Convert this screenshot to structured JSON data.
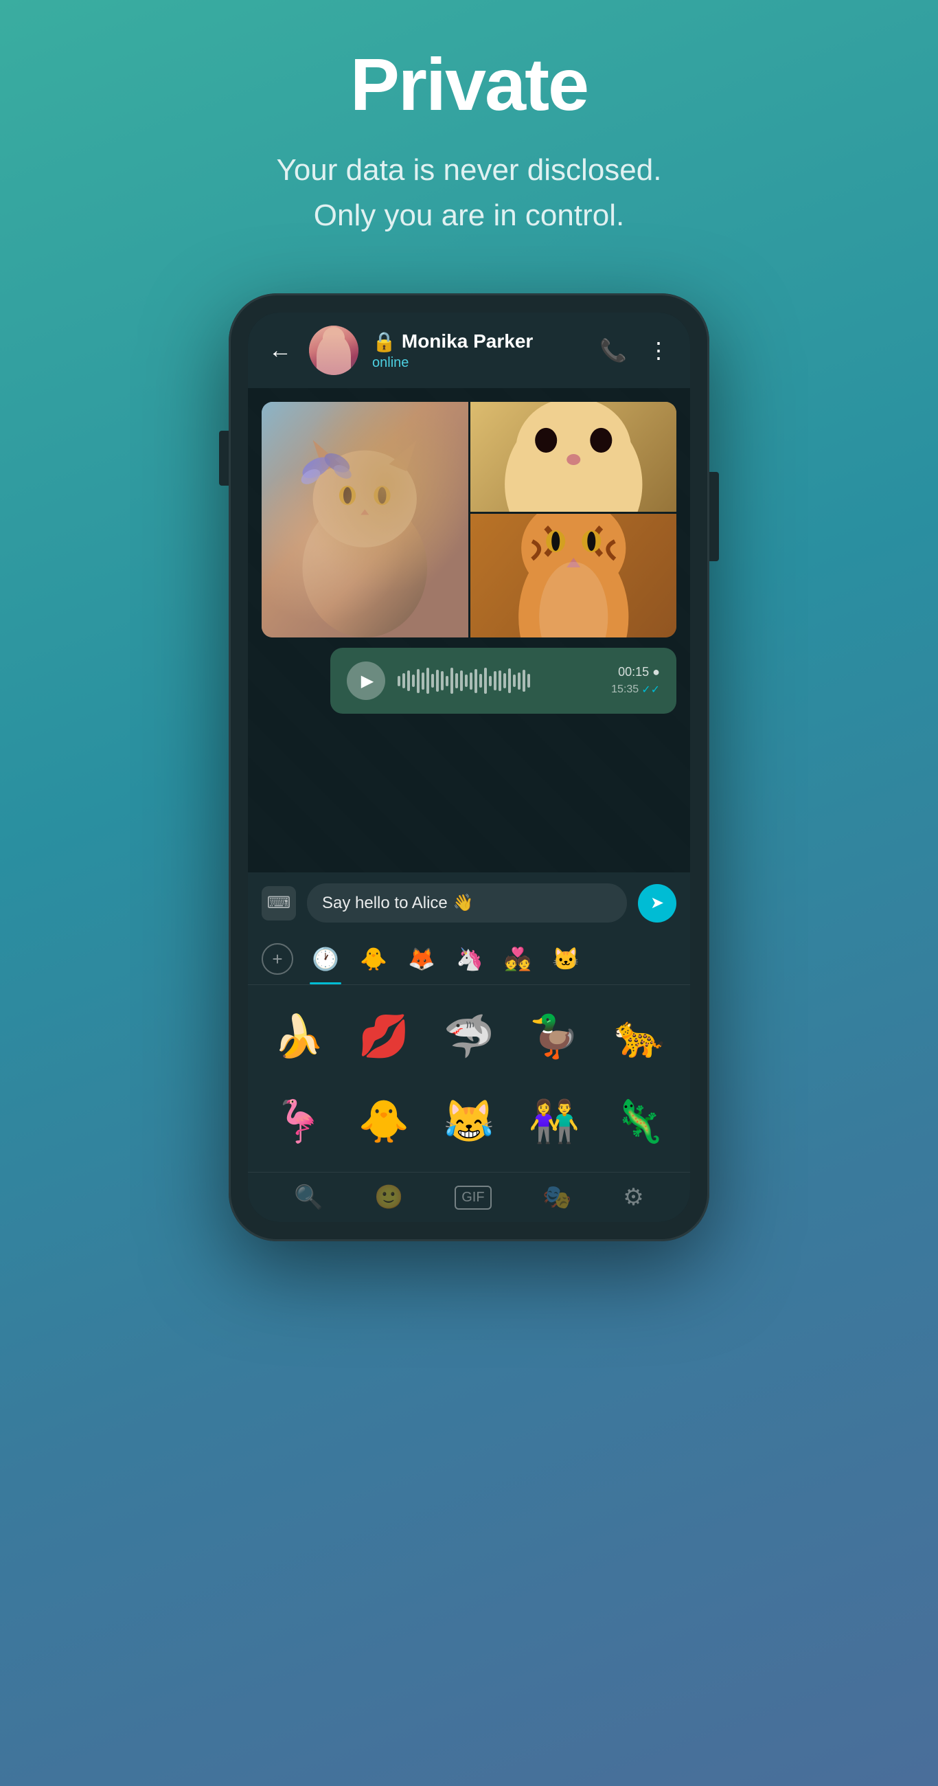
{
  "hero": {
    "title": "Private",
    "subtitle_line1": "Your data is never disclosed.",
    "subtitle_line2": "Only you are in control."
  },
  "chat": {
    "header": {
      "contact_name": "Monika Parker",
      "status": "online",
      "lock_symbol": "🔒"
    },
    "voice_message": {
      "duration": "00:15 ●",
      "time": "15:35",
      "read_ticks": "✓✓"
    },
    "input": {
      "text": "Say hello to Alice",
      "wave_emoji": "👋"
    },
    "sticker_tabs": [
      {
        "emoji": "🕐",
        "active": true
      },
      {
        "emoji": "🐥"
      },
      {
        "emoji": "🦊"
      },
      {
        "emoji": "🦄"
      },
      {
        "emoji": "💑"
      },
      {
        "emoji": "🐱"
      }
    ],
    "stickers_row1": [
      "🍌",
      "💋",
      "🦈",
      "🦆",
      "🐆"
    ],
    "stickers_row2": [
      "🦩",
      "🐥",
      "😹",
      "👫",
      "🦎"
    ],
    "bottom_bar": [
      "search",
      "emoji",
      "gif",
      "sticker",
      "settings"
    ]
  },
  "colors": {
    "teal_bg": "#3aada0",
    "phone_body": "#1a2a2e",
    "chat_bg": "#0f1e22",
    "header_bg": "#1a2d32",
    "voice_msg_bg": "#2d5a4a",
    "send_btn": "#00bcd4",
    "status_color": "#4dd0e1"
  }
}
